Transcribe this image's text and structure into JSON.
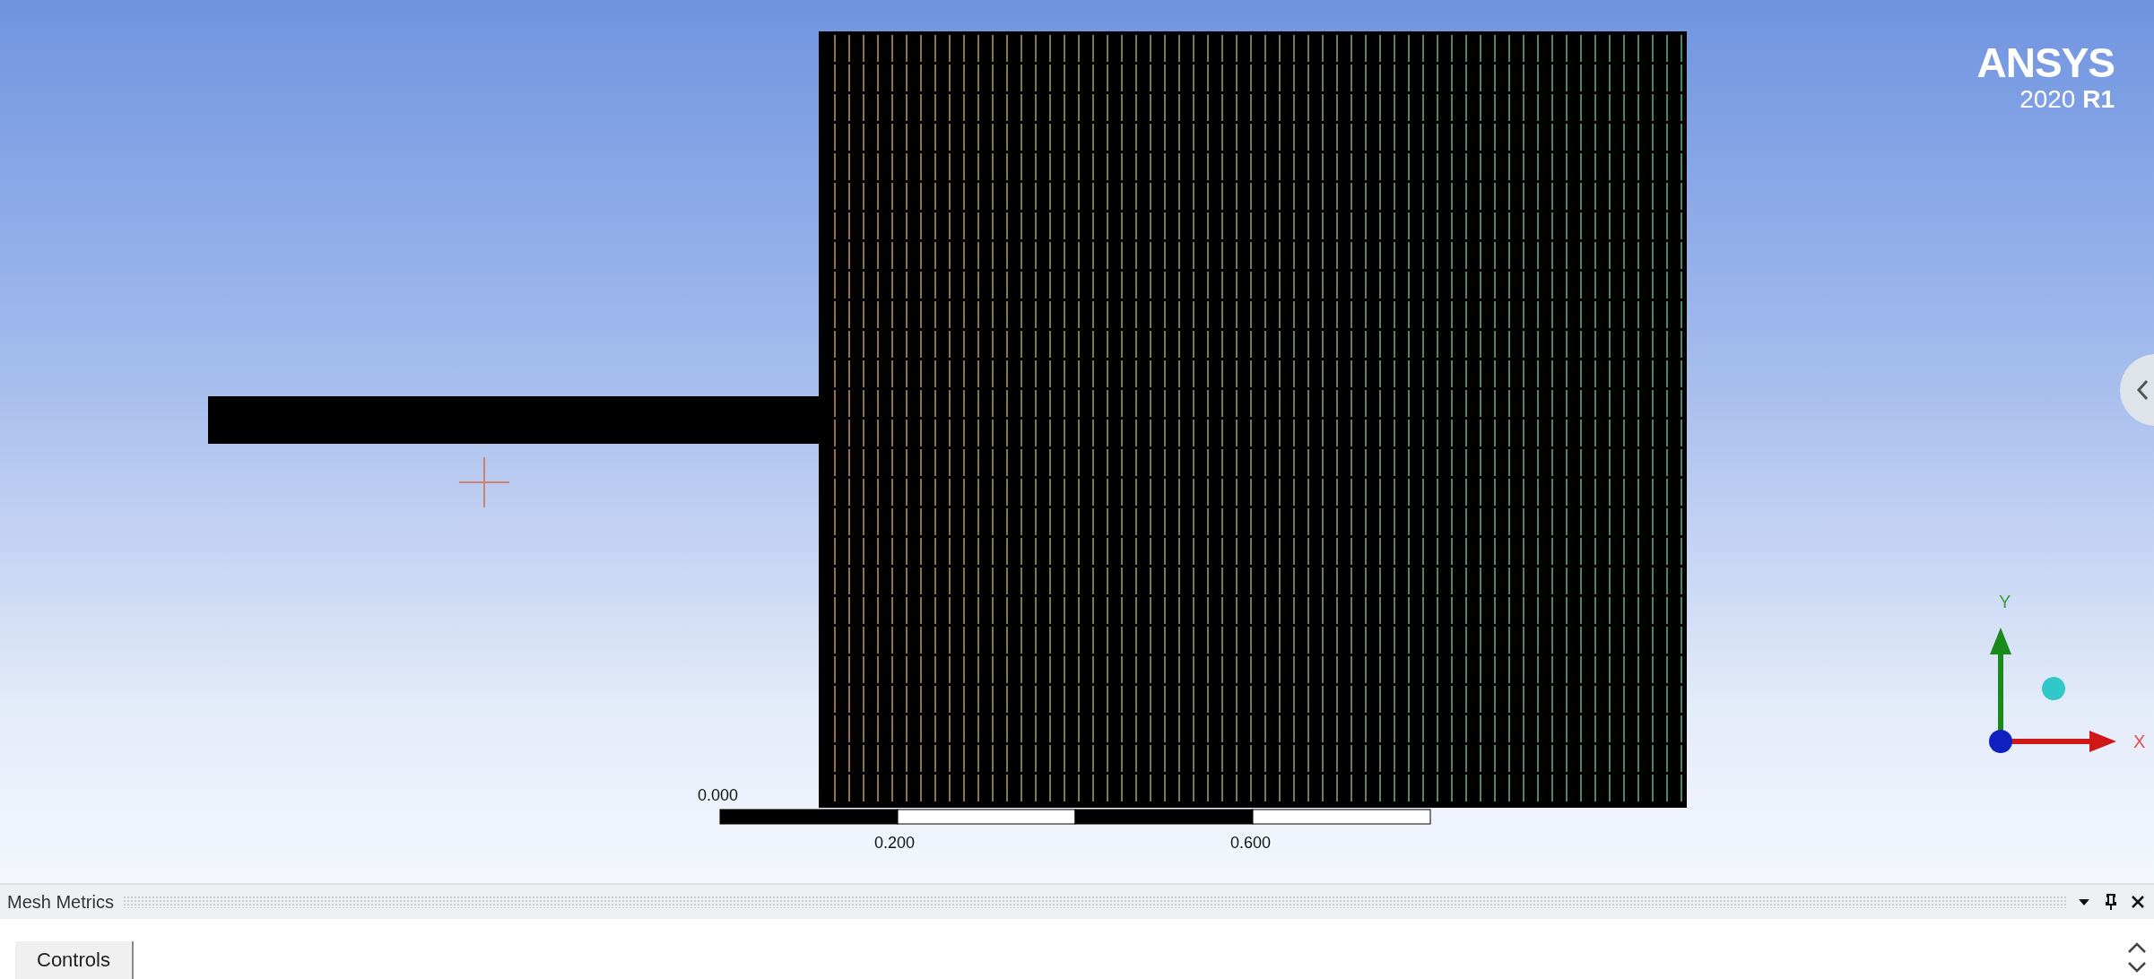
{
  "logo": {
    "name": "ANSYS",
    "version": "2020 **R1**"
  },
  "scale_bar": {
    "labels": [
      "0.000",
      "0.200",
      "0.600"
    ]
  },
  "triad": {
    "y_label": "Y",
    "x_label": "X"
  },
  "panel": {
    "title": "Mesh Metrics",
    "tabs": [
      {
        "label": "Controls",
        "selected": true
      }
    ]
  }
}
